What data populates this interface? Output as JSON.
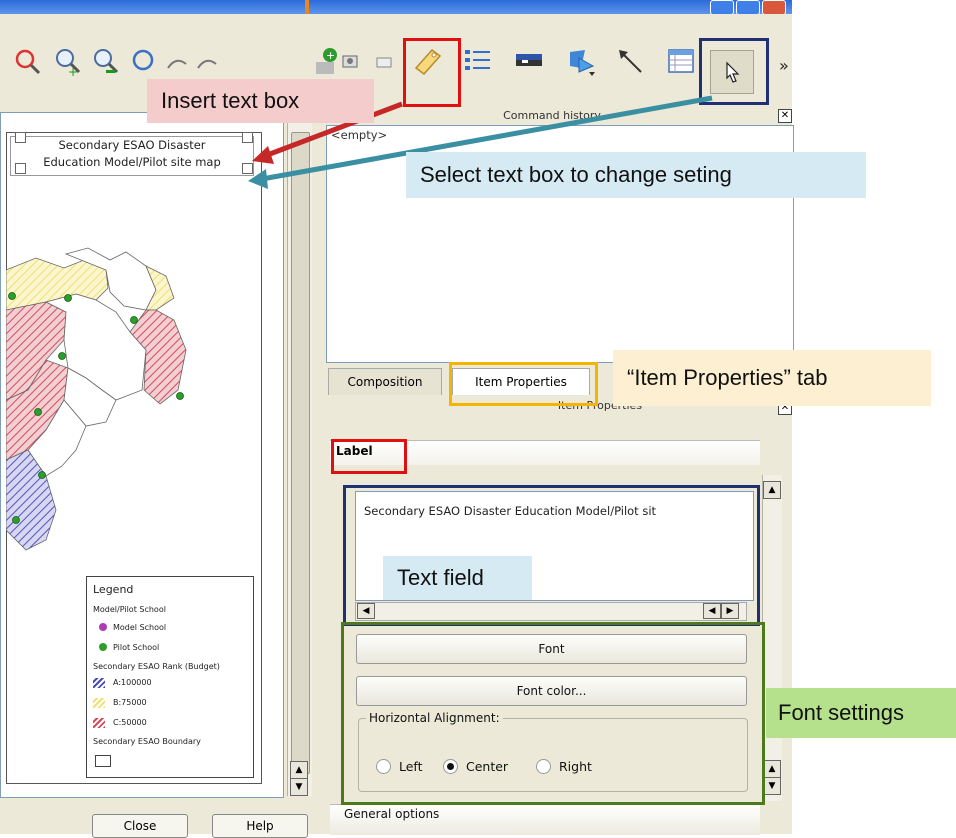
{
  "annotations": {
    "insert_text_box": "Insert text box",
    "select_text_box": "Select text box to change seting",
    "item_properties_tab": "“Item Properties” tab",
    "text_field": "Text field",
    "font_settings": "Font settings"
  },
  "map": {
    "title_line1": "Secondary ESAO Disaster",
    "title_line2": "Education Model/Pilot site map",
    "legend": {
      "heading": "Legend",
      "group1": "Model/Pilot School",
      "model": "Model School",
      "pilot": "Pilot School",
      "group2": "Secondary ESAO Rank (Budget)",
      "rank_a": "A:100000",
      "rank_b": "B:75000",
      "rank_c": "C:50000",
      "group3": "Secondary ESAO Boundary"
    }
  },
  "left_buttons": {
    "close": "Close",
    "help": "Help"
  },
  "command_history": {
    "header": "Command history",
    "content": "<empty>"
  },
  "tabs": {
    "composition": "Composition",
    "item_properties": "Item Properties"
  },
  "item_properties": {
    "header": "Item Properties",
    "section_label": "Label",
    "text_value": "Secondary ESAO Disaster Education Model/Pilot sit",
    "font_button": "Font",
    "font_color_button": "Font color...",
    "horizontal_alignment": "Horizontal Alignment:",
    "align_left": "Left",
    "align_center": "Center",
    "align_right": "Right",
    "selected_alignment": "Center",
    "general_options": "General options"
  },
  "toolbar": {
    "icons": [
      "zoom-full-icon",
      "zoom-in-icon",
      "zoom-out-icon",
      "refresh-icon",
      "pan-icon",
      "pan-item-icon",
      "add-map-icon",
      "add-image-icon",
      "add-label-icon",
      "add-legend-icon",
      "add-scalebar-icon",
      "add-shape-icon",
      "add-arrow-icon",
      "add-table-icon",
      "select-move-icon"
    ],
    "more": "»"
  },
  "colors": {
    "red": "#e01010",
    "navy": "#1f3170",
    "green": "#4e7a1e",
    "amber": "#f4b400",
    "callout_pink": "#f4cccc",
    "callout_blue": "#d6eaf3",
    "callout_cream": "#fdf0d2",
    "callout_green": "#b5e08c",
    "arrow_red": "#c62828",
    "arrow_teal": "#3a8fa3"
  }
}
